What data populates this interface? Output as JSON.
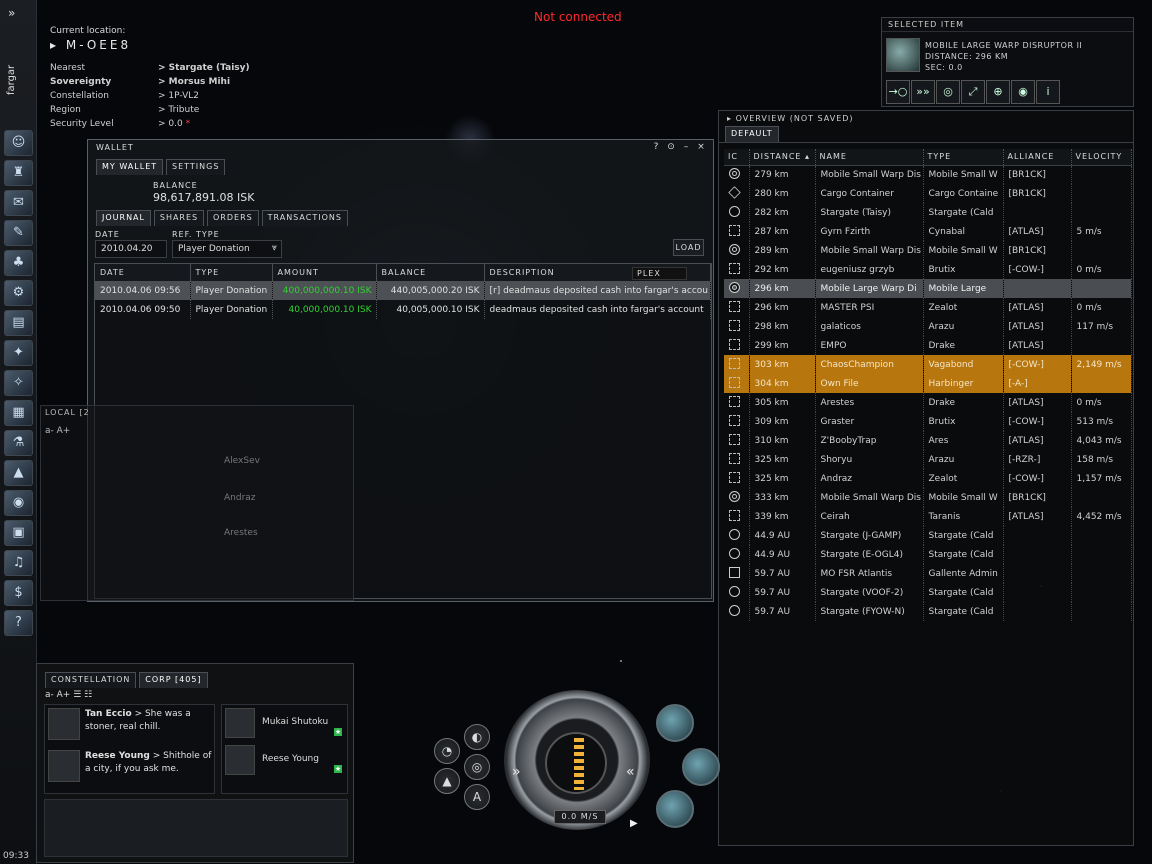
{
  "status": "Not connected",
  "clock": "09:33",
  "character_name": "fargar",
  "location": {
    "current_label": "Current location:",
    "system": "M-OEE8",
    "rows": [
      {
        "key": "Nearest",
        "value": "> Stargate (Taisy)"
      },
      {
        "key": "Sovereignty",
        "value": "> Morsus Mihi"
      },
      {
        "key": "Constellation",
        "value": "> 1P-VL2"
      },
      {
        "key": "Region",
        "value": "> Tribute"
      },
      {
        "key": "Security Level",
        "value": "> 0.0"
      }
    ],
    "security_dot": "*"
  },
  "selected_item": {
    "header": "SELECTED ITEM",
    "name": "MOBILE LARGE WARP DISRUPTOR II",
    "distance": "DISTANCE: 296 KM",
    "sec": "SEC: 0.0",
    "actions": [
      "approach-icon",
      "warp-icon",
      "orbit-icon",
      "keep-range-icon",
      "lock-target-icon",
      "look-at-icon",
      "info-icon"
    ]
  },
  "overview": {
    "header": "OVERVIEW (NOT SAVED)",
    "tab": "DEFAULT",
    "columns": [
      "IC",
      "DISTANCE",
      "NAME",
      "TYPE",
      "ALLIANCE",
      "VELOCITY"
    ],
    "rows": [
      {
        "icon": "target",
        "distance": "279 km",
        "name": "Mobile Small Warp Dis",
        "type": "Mobile Small W",
        "alliance": "[BR1CK]",
        "velocity": "",
        "state": ""
      },
      {
        "icon": "diamond",
        "distance": "280 km",
        "name": "Cargo Container",
        "type": "Cargo Containe",
        "alliance": "[BR1CK]",
        "velocity": "",
        "state": ""
      },
      {
        "icon": "gate",
        "distance": "282 km",
        "name": "Stargate (Taisy)",
        "type": "Stargate (Cald",
        "alliance": "",
        "velocity": "",
        "state": ""
      },
      {
        "icon": "ship",
        "distance": "287 km",
        "name": "Gyrn Fzirth",
        "type": "Cynabal",
        "alliance": "[ATLAS]",
        "velocity": "5 m/s",
        "state": ""
      },
      {
        "icon": "target",
        "distance": "289 km",
        "name": "Mobile Small Warp Dis",
        "type": "Mobile Small W",
        "alliance": "[BR1CK]",
        "velocity": "",
        "state": ""
      },
      {
        "icon": "ship",
        "distance": "292 km",
        "name": "eugeniusz grzyb",
        "type": "Brutix",
        "alliance": "[-COW-]",
        "velocity": "0 m/s",
        "state": ""
      },
      {
        "icon": "target",
        "distance": "296 km",
        "name": "Mobile Large Warp Di",
        "type": "Mobile Large",
        "alliance": "",
        "velocity": "",
        "state": "sel"
      },
      {
        "icon": "ship",
        "distance": "296 km",
        "name": "MASTER PSI",
        "type": "Zealot",
        "alliance": "[ATLAS]",
        "velocity": "0 m/s",
        "state": ""
      },
      {
        "icon": "ship",
        "distance": "298 km",
        "name": "galaticos",
        "type": "Arazu",
        "alliance": "[ATLAS]",
        "velocity": "117 m/s",
        "state": ""
      },
      {
        "icon": "ship",
        "distance": "299 km",
        "name": "EMPO",
        "type": "Drake",
        "alliance": "[ATLAS]",
        "velocity": "",
        "state": ""
      },
      {
        "icon": "ship",
        "distance": "303 km",
        "name": "ChaosChampion",
        "type": "Vagabond",
        "alliance": "[-COW-]",
        "velocity": "2,149 m/s",
        "state": "hl"
      },
      {
        "icon": "ship",
        "distance": "304 km",
        "name": "Own File",
        "type": "Harbinger",
        "alliance": "[-A-]",
        "velocity": "",
        "state": "hl"
      },
      {
        "icon": "ship",
        "distance": "305 km",
        "name": "Arestes",
        "type": "Drake",
        "alliance": "[ATLAS]",
        "velocity": "0 m/s",
        "state": ""
      },
      {
        "icon": "ship",
        "distance": "309 km",
        "name": "Graster",
        "type": "Brutix",
        "alliance": "[-COW-]",
        "velocity": "513 m/s",
        "state": ""
      },
      {
        "icon": "ship",
        "distance": "310 km",
        "name": "Z'BoobyTrap",
        "type": "Ares",
        "alliance": "[ATLAS]",
        "velocity": "4,043 m/s",
        "state": ""
      },
      {
        "icon": "ship",
        "distance": "325 km",
        "name": "Shoryu",
        "type": "Arazu",
        "alliance": "[-RZR-]",
        "velocity": "158 m/s",
        "state": ""
      },
      {
        "icon": "ship",
        "distance": "325 km",
        "name": "Andraz",
        "type": "Zealot",
        "alliance": "[-COW-]",
        "velocity": "1,157 m/s",
        "state": ""
      },
      {
        "icon": "target",
        "distance": "333 km",
        "name": "Mobile Small Warp Dis",
        "type": "Mobile Small W",
        "alliance": "[BR1CK]",
        "velocity": "",
        "state": ""
      },
      {
        "icon": "ship",
        "distance": "339 km",
        "name": "Ceirah",
        "type": "Taranis",
        "alliance": "[ATLAS]",
        "velocity": "4,452 m/s",
        "state": ""
      },
      {
        "icon": "gate",
        "distance": "44.9 AU",
        "name": "Stargate (J-GAMP)",
        "type": "Stargate (Cald",
        "alliance": "",
        "velocity": "",
        "state": ""
      },
      {
        "icon": "gate",
        "distance": "44.9 AU",
        "name": "Stargate (E-OGL4)",
        "type": "Stargate (Cald",
        "alliance": "",
        "velocity": "",
        "state": ""
      },
      {
        "icon": "struct",
        "distance": "59.7 AU",
        "name": "MO FSR Atlantis",
        "type": "Gallente Admin",
        "alliance": "",
        "velocity": "",
        "state": ""
      },
      {
        "icon": "gate",
        "distance": "59.7 AU",
        "name": "Stargate (VOOF-2)",
        "type": "Stargate (Cald",
        "alliance": "",
        "velocity": "",
        "state": ""
      },
      {
        "icon": "gate",
        "distance": "59.7 AU",
        "name": "Stargate (FYOW-N)",
        "type": "Stargate (Cald",
        "alliance": "",
        "velocity": "",
        "state": ""
      }
    ]
  },
  "wallet": {
    "title": "WALLET",
    "tabs": [
      "MY WALLET",
      "SETTINGS"
    ],
    "balance_label": "BALANCE",
    "balance": "98,617,891.08 ISK",
    "subtabs": [
      "JOURNAL",
      "SHARES",
      "ORDERS",
      "TRANSACTIONS"
    ],
    "date_label": "DATE",
    "ref_type_label": "REF. TYPE",
    "date_value": "2010.04.20",
    "ref_type_value": "Player Donation",
    "load_label": "LOAD",
    "plex_label": "PLEX",
    "columns": [
      "DATE",
      "TYPE",
      "AMOUNT",
      "BALANCE",
      "DESCRIPTION"
    ],
    "rows": [
      {
        "date": "2010.04.06 09:56",
        "type": "Player Donation",
        "amount": "400,000,000.10 ISK",
        "balance": "440,005,000.20 ISK",
        "description": "[r] deadmaus deposited cash into fargar's accou",
        "selected": true
      },
      {
        "date": "2010.04.06 09:50",
        "type": "Player Donation",
        "amount": "40,000,000.10 ISK",
        "balance": "40,005,000.10 ISK",
        "description": "deadmaus deposited cash into fargar's account",
        "selected": false
      }
    ]
  },
  "local": {
    "header": "LOCAL [2",
    "font_down": "a-",
    "font_up": "A+",
    "members": [
      "AlexSev",
      "Andraz",
      "Arestes"
    ]
  },
  "corp_chat": {
    "tabs": [
      "CONSTELLATION",
      "CORP [405]"
    ],
    "font_down": "a-",
    "font_up": "A+",
    "messages": [
      {
        "name": "Tan Eccio",
        "text": "> She was a stoner, real chill."
      },
      {
        "name": "Reese Young",
        "text": "> Shithole of a city, if you ask me."
      }
    ],
    "members": [
      "Mukai Shutoku",
      "Reese Young"
    ]
  },
  "hud": {
    "speed": "0.0 M/S",
    "speed_down": "«",
    "speed_up": "»"
  },
  "colors": {
    "status": "#ff2a2a",
    "sovereignty": "#e09a2a",
    "highlight_row": "#b8760e",
    "positive_amount": "#32d232"
  }
}
